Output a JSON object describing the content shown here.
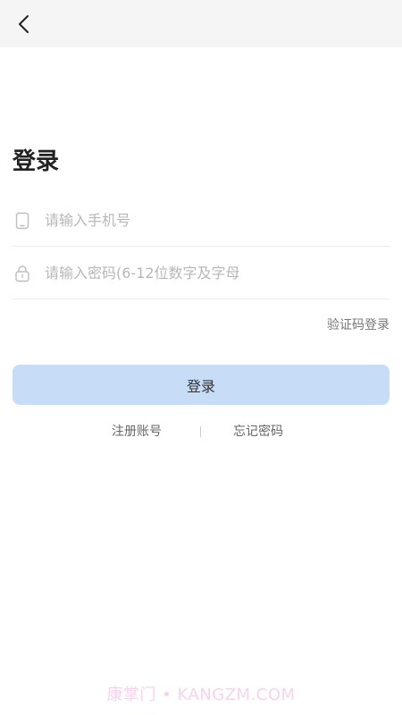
{
  "header": {
    "back_icon": "chevron-left-icon"
  },
  "title": "登录",
  "phone_field": {
    "icon": "phone-icon",
    "value": "",
    "placeholder": "请输入手机号"
  },
  "password_field": {
    "icon": "lock-icon",
    "value": "",
    "placeholder": "请输入密码(6-12位数字及字母"
  },
  "sms_login_link": "验证码登录",
  "login_button": {
    "label": "登录",
    "color": "#c6dcf7"
  },
  "links": {
    "register": "注册账号",
    "forgot_password": "忘记密码"
  },
  "watermark": "康掌门 • KANGZM.COM"
}
